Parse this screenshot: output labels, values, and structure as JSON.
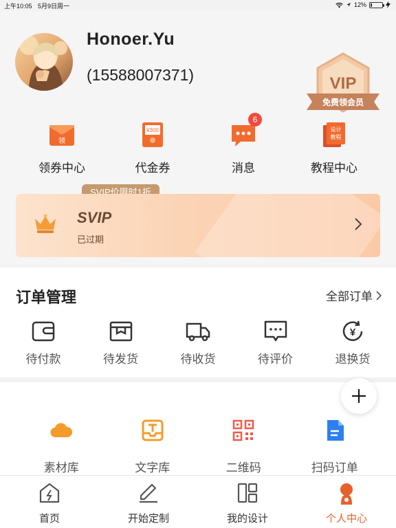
{
  "status_bar": {
    "time": "上午10:05",
    "date": "5月9日周一",
    "battery": "12%",
    "battery_level": 0.12
  },
  "profile": {
    "name": "Honoer.Yu",
    "phone": "(15588007371)"
  },
  "vip_badge": {
    "label": "VIP",
    "ribbon": "免费领会员"
  },
  "quick_actions": [
    {
      "label": "领券中心",
      "icon": "coupon-envelope-icon",
      "icon_text": "领"
    },
    {
      "label": "代金券",
      "icon": "voucher-icon",
      "icon_text": "¥300"
    },
    {
      "label": "消息",
      "icon": "message-icon",
      "badge": "6"
    },
    {
      "label": "教程中心",
      "icon": "tutorial-book-icon",
      "icon_text_1": "设计",
      "icon_text_2": "教程"
    }
  ],
  "svip": {
    "tag": "SVIP价限时1折",
    "title": "SVIP",
    "status": "已过期"
  },
  "orders": {
    "title": "订单管理",
    "all_label": "全部订单",
    "items": [
      {
        "label": "待付款",
        "icon": "wallet-icon"
      },
      {
        "label": "待发货",
        "icon": "box-icon"
      },
      {
        "label": "待收货",
        "icon": "truck-icon"
      },
      {
        "label": "待评价",
        "icon": "comment-icon"
      },
      {
        "label": "退换货",
        "icon": "refund-icon"
      }
    ]
  },
  "tools": [
    {
      "label": "素材库",
      "icon": "cloud-icon"
    },
    {
      "label": "文字库",
      "icon": "text-tray-icon"
    },
    {
      "label": "二维码",
      "icon": "qrcode-icon"
    },
    {
      "label": "扫码订单",
      "icon": "document-icon"
    }
  ],
  "tabs": [
    {
      "label": "首页",
      "icon": "home-icon",
      "active": false
    },
    {
      "label": "开始定制",
      "icon": "pen-icon",
      "active": false
    },
    {
      "label": "我的设计",
      "icon": "layout-icon",
      "active": false
    },
    {
      "label": "个人中心",
      "icon": "person-icon",
      "active": true
    }
  ],
  "colors": {
    "accent": "#e8612c",
    "badge": "#f04a3c",
    "gold": "#c59b6e",
    "svip_text": "#6a4a32"
  }
}
